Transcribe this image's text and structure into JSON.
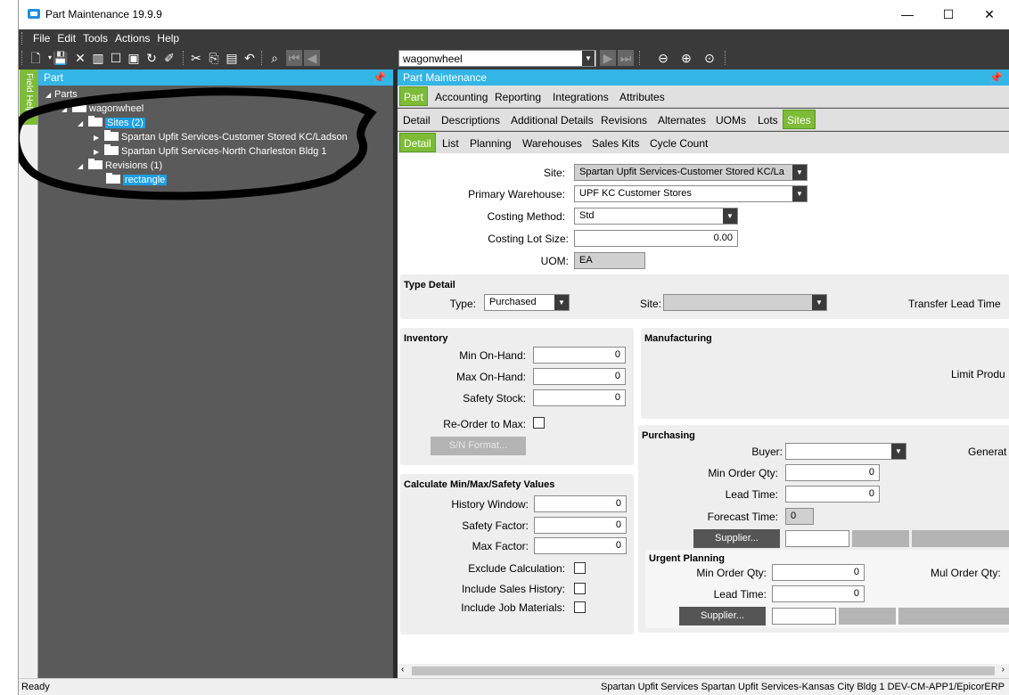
{
  "window": {
    "title": "Part Maintenance 19.9.9",
    "minimize": "—",
    "maximize": "☐",
    "close": "✕"
  },
  "menu": [
    "File",
    "Edit",
    "Tools",
    "Actions",
    "Help"
  ],
  "toolbar": {
    "search_value": "wagonwheel"
  },
  "left_panel": {
    "header": "Part",
    "field_help": "Field Help",
    "tree": {
      "root": "Parts",
      "part": "wagonwheel",
      "sites_node": "Sites (2)",
      "site1": "Spartan Upfit Services-Customer Stored KC/Ladson",
      "site2": "Spartan Upfit Services-North Charleston Bldg 1",
      "revisions_node": "Revisions (1)",
      "revision1": "rectangle"
    }
  },
  "right_panel": {
    "header": "Part Maintenance",
    "tabs_top": [
      "Part",
      "Accounting",
      "Reporting",
      "Integrations",
      "Attributes"
    ],
    "tabs_mid": [
      "Detail",
      "Descriptions",
      "Additional Details",
      "Revisions",
      "Alternates",
      "UOMs",
      "Lots",
      "Sites"
    ],
    "tabs_low": [
      "Detail",
      "List",
      "Planning",
      "Warehouses",
      "Sales Kits",
      "Cycle Count"
    ]
  },
  "form": {
    "site_label": "Site:",
    "site_value": "Spartan Upfit Services-Customer Stored KC/La",
    "warehouse_label": "Primary Warehouse:",
    "warehouse_value": "UPF KC Customer Stores",
    "costing_label": "Costing Method:",
    "costing_value": "Std",
    "lotsize_label": "Costing Lot Size:",
    "lotsize_value": "0.00",
    "uom_label": "UOM:",
    "uom_value": "EA",
    "type_detail": {
      "title": "Type Detail",
      "type_label": "Type:",
      "type_value": "Purchased",
      "site_label": "Site:",
      "transfer_label": "Transfer Lead Time"
    },
    "inventory": {
      "title": "Inventory",
      "min_label": "Min On-Hand:",
      "min_value": "0",
      "max_label": "Max On-Hand:",
      "max_value": "0",
      "safety_label": "Safety Stock:",
      "safety_value": "0",
      "reorder_label": "Re-Order to Max:",
      "sn_button": "S/N Format..."
    },
    "calc": {
      "title": "Calculate Min/Max/Safety Values",
      "history_label": "History Window:",
      "history_value": "0",
      "sfactor_label": "Safety Factor:",
      "sfactor_value": "0",
      "mfactor_label": "Max Factor:",
      "mfactor_value": "0",
      "exclude_label": "Exclude Calculation:",
      "sales_label": "Include Sales History:",
      "job_label": "Include Job Materials:"
    },
    "manufacturing": {
      "title": "Manufacturing",
      "limit_label": "Limit Produ"
    },
    "purchasing": {
      "title": "Purchasing",
      "buyer_label": "Buyer:",
      "generate_label": "Generat",
      "minqty_label": "Min Order Qty:",
      "minqty_value": "0",
      "lead_label": "Lead Time:",
      "lead_value": "0",
      "forecast_label": "Forecast Time:",
      "forecast_value": "0",
      "supplier_button": "Supplier..."
    },
    "urgent": {
      "title": "Urgent Planning",
      "minqty_label": "Min Order Qty:",
      "minqty_value": "0",
      "mulqty_label": "Mul Order Qty:",
      "lead_label": "Lead Time:",
      "lead_value": "0",
      "supplier_button": "Supplier..."
    }
  },
  "status": {
    "left": "Ready",
    "right": "Spartan Upfit Services  Spartan Upfit Services-Kansas City Bldg 1  DEV-CM-APP1/EpicorERP"
  }
}
